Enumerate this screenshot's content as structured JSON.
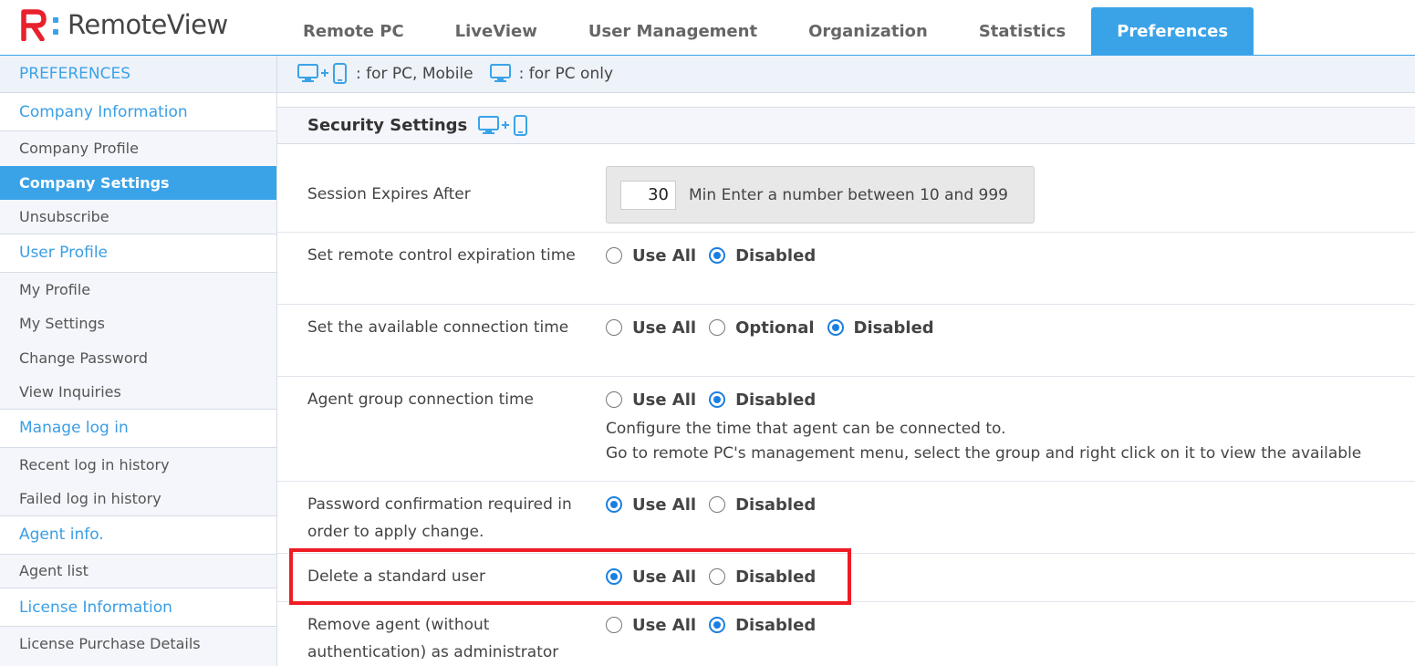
{
  "app": {
    "name": "RemoteView"
  },
  "nav": {
    "tabs": [
      {
        "label": "Remote PC"
      },
      {
        "label": "LiveView"
      },
      {
        "label": "User Management"
      },
      {
        "label": "Organization"
      },
      {
        "label": "Statistics"
      },
      {
        "label": "Preferences"
      }
    ],
    "active_tab": "Preferences"
  },
  "sidebar": {
    "header": "PREFERENCES",
    "sections": [
      {
        "title": "Company Information",
        "items": [
          "Company Profile",
          "Company Settings",
          "Unsubscribe"
        ]
      },
      {
        "title": "User Profile",
        "items": [
          "My Profile",
          "My Settings",
          "Change Password",
          "View Inquiries"
        ]
      },
      {
        "title": "Manage log in",
        "items": [
          "Recent log in history",
          "Failed log in history"
        ]
      },
      {
        "title": "Agent info.",
        "items": [
          "Agent list"
        ]
      },
      {
        "title": "License Information",
        "items": [
          "License Purchase Details"
        ]
      }
    ],
    "active_item": "Company Settings"
  },
  "legend": {
    "pc_mobile": ": for PC, Mobile",
    "pc_only": ": for PC only"
  },
  "section": {
    "title": "Security Settings"
  },
  "session": {
    "label": "Session Expires After",
    "value": "30",
    "hint": "Min Enter a number between 10 and 999"
  },
  "settings": [
    {
      "label": "Set remote control expiration time",
      "options": [
        "Use All",
        "Disabled"
      ],
      "selected": "Disabled"
    },
    {
      "label": "Set the available connection time",
      "options": [
        "Use All",
        "Optional",
        "Disabled"
      ],
      "selected": "Disabled"
    },
    {
      "label": "Agent group connection time",
      "options": [
        "Use All",
        "Disabled"
      ],
      "selected": "Disabled",
      "description": [
        "Configure the time that agent can be connected to.",
        "Go to remote PC's management menu, select the group and right click on it to view the available"
      ]
    },
    {
      "label": "Password confirmation required in order to apply change.",
      "options": [
        "Use All",
        "Disabled"
      ],
      "selected": "Use All"
    },
    {
      "label": "Delete a standard user",
      "options": [
        "Use All",
        "Disabled"
      ],
      "selected": "Use All"
    },
    {
      "label": "Remove agent (without authentication) as administrator",
      "options": [
        "Use All",
        "Disabled"
      ],
      "selected": "Disabled"
    }
  ],
  "colors": {
    "accent": "#3aa3e8",
    "radio": "#1a7fe0",
    "highlight": "#ee1c24",
    "logo_red": "#e8212c"
  }
}
